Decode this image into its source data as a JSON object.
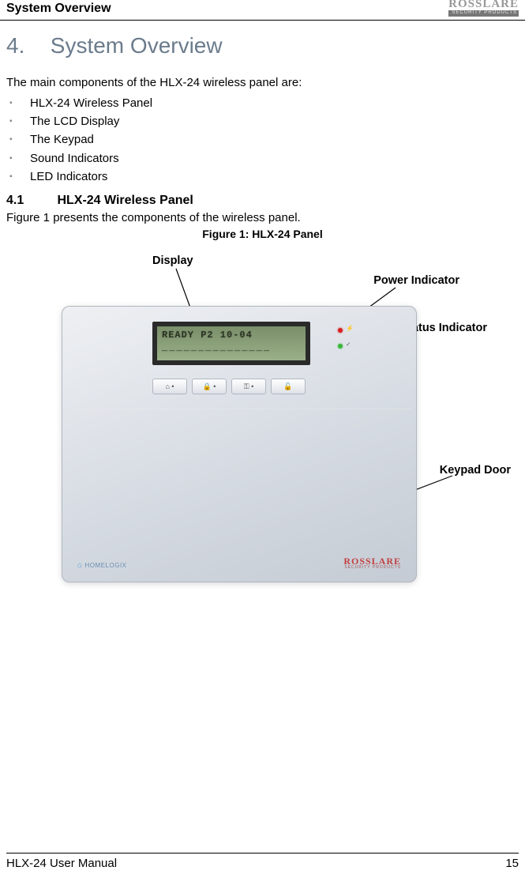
{
  "header": {
    "section_title": "System Overview",
    "brand_logo_top": "ROSSLARE",
    "brand_logo_bottom": "SECURITY PRODUCTS"
  },
  "chapter": {
    "number": "4.",
    "title": "System Overview"
  },
  "intro": "The main components of the HLX-24 wireless panel are:",
  "components": [
    "HLX-24 Wireless Panel",
    "The LCD Display",
    "The Keypad",
    "Sound Indicators",
    "LED Indicators"
  ],
  "subsection": {
    "number": "4.1",
    "title": "HLX-24 Wireless Panel"
  },
  "subsection_intro": "Figure 1 presents the components of the wireless panel.",
  "figure_caption": "Figure 1: HLX-24 Panel",
  "annotations": {
    "display": "Display",
    "power_indicator": "Power Indicator",
    "status_indicator": "Status Indicator",
    "keypad_door": "Keypad Door"
  },
  "panel": {
    "lcd_line1": "READY  P2 10-04",
    "lcd_line2": "_______________",
    "buttons": [
      "⌂ •",
      "🔒 •",
      "⚿ •",
      "🔓"
    ],
    "footer_left_icon": "⌂",
    "footer_left_text": "HOMELOGIX",
    "footer_right_top": "ROSSLARE",
    "footer_right_bottom": "SECURITY PRODUCTS",
    "power_led_icon": "⚡",
    "status_led_icon": "✓"
  },
  "footer": {
    "manual_name": "HLX-24 User Manual",
    "page_number": "15"
  }
}
